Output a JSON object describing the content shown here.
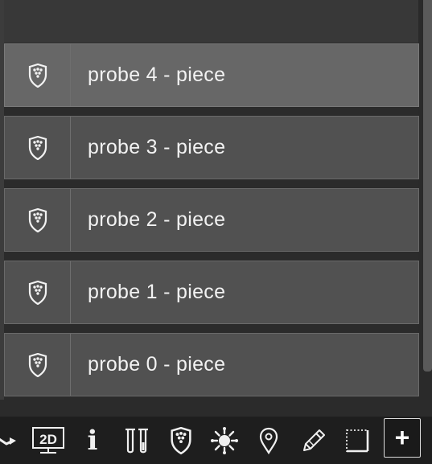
{
  "layers": [
    {
      "label": "probe 4 - piece",
      "icon": "shield-dots-icon",
      "active": true
    },
    {
      "label": "probe 3 - piece",
      "icon": "shield-dots-icon",
      "active": false
    },
    {
      "label": "probe 2 - piece",
      "icon": "shield-dots-icon",
      "active": false
    },
    {
      "label": "probe 1 - piece",
      "icon": "shield-dots-icon",
      "active": false
    },
    {
      "label": "probe 0 - piece",
      "icon": "shield-dots-icon",
      "active": false
    }
  ],
  "toolbar": {
    "items": [
      {
        "name": "arrow-icon"
      },
      {
        "name": "2d-view-icon",
        "text": "2D"
      },
      {
        "name": "info-icon",
        "text": "i"
      },
      {
        "name": "test-tubes-icon"
      },
      {
        "name": "shield-dots-icon"
      },
      {
        "name": "virus-icon"
      },
      {
        "name": "location-pin-icon"
      },
      {
        "name": "pencil-icon"
      },
      {
        "name": "crop-frame-icon"
      },
      {
        "name": "add-icon",
        "text": "+"
      }
    ]
  },
  "colors": {
    "row_bg": "#515151",
    "row_active_bg": "#676767",
    "toolbar_bg": "#1e1e1e",
    "panel_bg": "#383838"
  }
}
